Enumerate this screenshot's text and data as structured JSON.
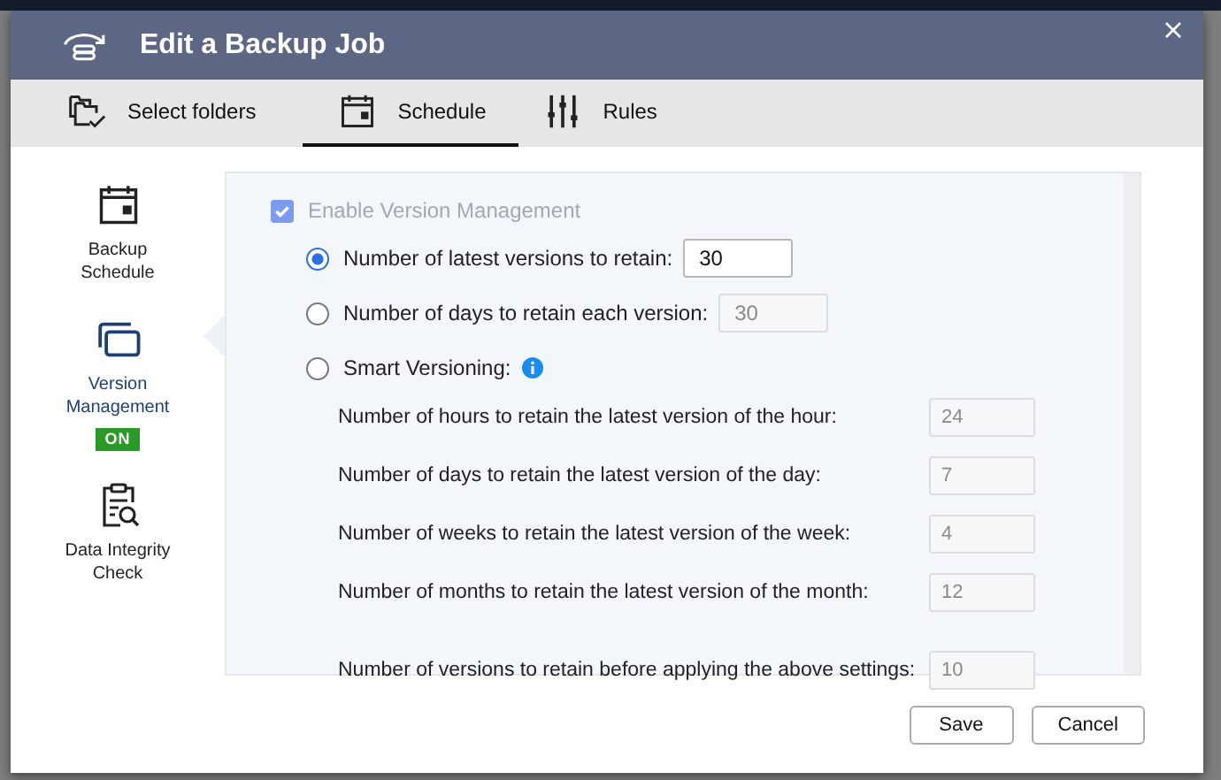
{
  "window": {
    "title": "Edit a Backup Job"
  },
  "tabs": [
    {
      "label": "Select folders",
      "selected": false
    },
    {
      "label": "Schedule",
      "selected": true
    },
    {
      "label": "Rules",
      "selected": false
    }
  ],
  "sidebar": {
    "items": [
      {
        "label": "Backup Schedule",
        "selected": false
      },
      {
        "label": "Version Management",
        "selected": true,
        "badge": "ON"
      },
      {
        "label": "Data Integrity Check",
        "selected": false
      }
    ]
  },
  "version_management": {
    "enable": {
      "label": "Enable Version Management",
      "checked": true,
      "disabled": true
    },
    "options": [
      {
        "label": "Number of latest versions to retain:",
        "selected": true,
        "value": "30",
        "disabled": false
      },
      {
        "label": "Number of days to retain each version:",
        "selected": false,
        "value": "30",
        "disabled": true
      },
      {
        "label": "Smart Versioning:",
        "selected": false,
        "info": true
      }
    ],
    "smart_fields": [
      {
        "label": "Number of hours to retain the latest version of the hour:",
        "value": "24",
        "disabled": true
      },
      {
        "label": "Number of days to retain the latest version of the day:",
        "value": "7",
        "disabled": true
      },
      {
        "label": "Number of weeks to retain the latest version of the week:",
        "value": "4",
        "disabled": true
      },
      {
        "label": "Number of months to retain the latest version of the month:",
        "value": "12",
        "disabled": true
      },
      {
        "label": "Number of versions to retain before applying the above settings:",
        "value": "10",
        "disabled": true
      }
    ]
  },
  "buttons": [
    "Save",
    "Cancel"
  ]
}
